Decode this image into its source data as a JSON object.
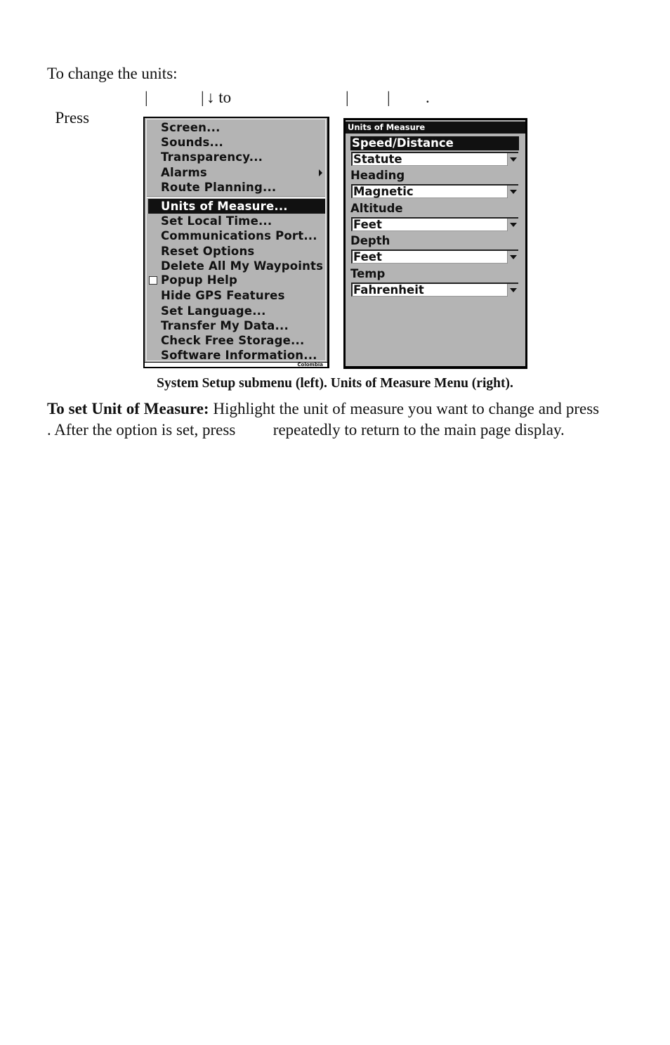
{
  "intro": {
    "line1": "To change the units:",
    "line2_press": "Press",
    "line2_to": "↓ to",
    "line2_end": "."
  },
  "system_setup_menu": {
    "items": [
      {
        "label": "Screen..."
      },
      {
        "label": "Sounds..."
      },
      {
        "label": "Transparency..."
      },
      {
        "label": "Alarms",
        "submenu": true
      },
      {
        "label": "Route Planning..."
      },
      {
        "label": "Units of Measure...",
        "selected": true
      },
      {
        "label": "Set Local Time..."
      },
      {
        "label": "Communications Port..."
      },
      {
        "label": "Reset Options"
      },
      {
        "label": "Delete All My Waypoints"
      },
      {
        "label": "Popup Help",
        "checkbox": true,
        "checked": false
      },
      {
        "label": "Hide GPS Features"
      },
      {
        "label": "Set Language..."
      },
      {
        "label": "Transfer My Data..."
      },
      {
        "label": "Check Free Storage..."
      },
      {
        "label": "Software Information..."
      }
    ],
    "footer_fragment": "Colombia"
  },
  "units_menu": {
    "title": "Units of Measure",
    "fields": [
      {
        "label": "Speed/Distance",
        "value": "Statute",
        "selected": true
      },
      {
        "label": "Heading",
        "value": "Magnetic"
      },
      {
        "label": "Altitude",
        "value": "Feet"
      },
      {
        "label": "Depth",
        "value": "Feet"
      },
      {
        "label": "Temp",
        "value": "Fahrenheit"
      }
    ]
  },
  "caption": "System Setup submenu (left). Units of Measure Menu (right).",
  "body": {
    "lead": "To set Unit of Measure:",
    "text1": " Highlight the unit of measure you want to change and press ",
    "text2": ". After the option is set, press ",
    "text3": " repeatedly to return to the main page display."
  }
}
